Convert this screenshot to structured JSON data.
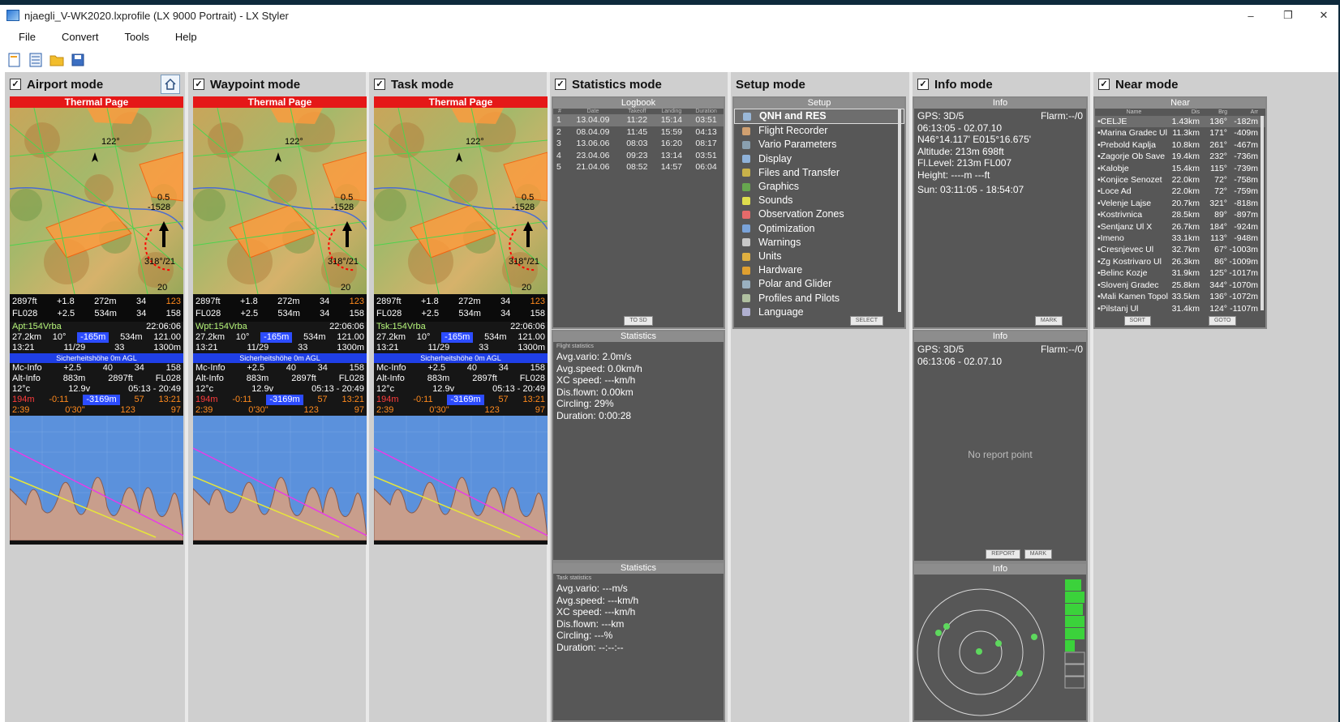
{
  "window": {
    "title": "njaegli_V-WK2020.lxprofile (LX 9000 Portrait) - LX Styler",
    "minimize": "–",
    "restore": "❐",
    "close": "✕"
  },
  "menu": [
    "File",
    "Convert",
    "Tools",
    "Help"
  ],
  "toolbar": {
    "icons": [
      "new-icon",
      "list-icon",
      "open-folder-icon",
      "save-icon"
    ]
  },
  "columns": {
    "airport": {
      "title": "Airport mode",
      "checked": true
    },
    "waypoint": {
      "title": "Waypoint mode",
      "checked": true
    },
    "task": {
      "title": "Task mode",
      "checked": true
    },
    "statistics": {
      "title": "Statistics mode",
      "checked": true
    },
    "setup": {
      "title": "Setup mode",
      "checked": false
    },
    "info": {
      "title": "Info mode",
      "checked": true
    },
    "near": {
      "title": "Near mode",
      "checked": true
    }
  },
  "devices": [
    {
      "id": "airport",
      "map_title": "Thermal Page",
      "nav_name": "Apt:154Vrba",
      "time": "22:06:06",
      "alt": "2897ft",
      "fl": "FL028",
      "vario": "+1.8",
      "agl": "272m",
      "mc": "34",
      "gs": "123"
    },
    {
      "id": "waypoint",
      "map_title": "Thermal Page",
      "nav_name": "Wpt:154Vrba",
      "time": "22:06:06",
      "alt": "2897ft",
      "fl": "FL028",
      "vario": "+1.8",
      "agl": "272m",
      "mc": "34",
      "gs": "123"
    },
    {
      "id": "task",
      "map_title": "Thermal Page",
      "nav_name": "Tsk:154Vrba",
      "time": "22:06:06",
      "alt": "2897ft",
      "fl": "FL028",
      "vario": "+1.8",
      "agl": "272m",
      "mc": "34",
      "gs": "123"
    }
  ],
  "device_common": {
    "bearing": "122°",
    "wind": "318°/21",
    "wind_alt": "0.5",
    "wind_val": "-1528",
    "scale": "20",
    "nav_row1": [
      "27.2km",
      "10°",
      "-165m",
      "534m",
      "121.00"
    ],
    "nav_row2": [
      "13:21",
      "11/29",
      "33",
      "1300m"
    ],
    "safety": "Sicherheitshöhe 0m AGL",
    "mc_info": "Mc-Info",
    "mc_vals": [
      "+2.5",
      "40",
      "34",
      "158"
    ],
    "alt_info": "Alt-Info",
    "alt_vals": [
      "883m",
      "2897ft",
      "FL028"
    ],
    "row_oat": [
      "12°c",
      "12.9v",
      "05:13 - 20:49"
    ],
    "row_red": [
      "194m",
      "-0:11",
      "-3169m",
      "57",
      "13:21"
    ],
    "row_time": [
      "2:39",
      "0'30\"",
      "123",
      "97"
    ]
  },
  "statistics": {
    "logbook_title": "Logbook",
    "log_headers": [
      "#",
      "Date",
      "Takeoff",
      "Landing",
      "Duration"
    ],
    "log_rows": [
      [
        "1",
        "13.04.09",
        "11:22",
        "15:14",
        "03:51"
      ],
      [
        "2",
        "08.04.09",
        "11:45",
        "15:59",
        "04:13"
      ],
      [
        "3",
        "13.06.06",
        "08:03",
        "16:20",
        "08:17"
      ],
      [
        "4",
        "23.04.06",
        "09:23",
        "13:14",
        "03:51"
      ],
      [
        "5",
        "21.04.06",
        "08:52",
        "14:57",
        "06:04"
      ]
    ],
    "to_sd": "TO SD",
    "flight_title": "Statistics",
    "flight_sub": "Flight statistics",
    "flight_lines": [
      "Avg.vario:  2.0m/s",
      "Avg.speed: 0.0km/h",
      "XC speed: ---km/h",
      "Dis.flown: 0.00km",
      "Circling: 29%",
      "Duration:  0:00:28"
    ],
    "task_title": "Statistics",
    "task_sub": "Task statistics",
    "task_lines": [
      "Avg.vario: ---m/s",
      "Avg.speed: ---km/h",
      "XC speed: ---km/h",
      "Dis.flown: ---km",
      "Circling: ---%",
      "Duration: --:--:--"
    ]
  },
  "setup": {
    "title": "Setup",
    "items": [
      {
        "label": "QNH and RES",
        "icon": "qnh-icon",
        "color": "#9ab8d8"
      },
      {
        "label": "Flight Recorder",
        "icon": "recorder-icon",
        "color": "#d0a070"
      },
      {
        "label": "Vario Parameters",
        "icon": "vario-icon",
        "color": "#8aa0b0"
      },
      {
        "label": "Display",
        "icon": "display-icon",
        "color": "#8fb2d9"
      },
      {
        "label": "Files and Transfer",
        "icon": "files-icon",
        "color": "#c9b24a"
      },
      {
        "label": "Graphics",
        "icon": "graphics-icon",
        "color": "#67a74f"
      },
      {
        "label": "Sounds",
        "icon": "sounds-icon",
        "color": "#dede4d"
      },
      {
        "label": "Observation Zones",
        "icon": "zones-icon",
        "color": "#e66a6a"
      },
      {
        "label": "Optimization",
        "icon": "optimization-icon",
        "color": "#7aa3d9"
      },
      {
        "label": "Warnings",
        "icon": "warnings-icon",
        "color": "#c8c8c8"
      },
      {
        "label": "Units",
        "icon": "units-icon",
        "color": "#e0b040"
      },
      {
        "label": "Hardware",
        "icon": "hardware-icon",
        "color": "#e0a030"
      },
      {
        "label": "Polar and Glider",
        "icon": "polar-icon",
        "color": "#9ab0c0"
      },
      {
        "label": "Profiles and Pilots",
        "icon": "profiles-icon",
        "color": "#b0c0a0"
      },
      {
        "label": "Language",
        "icon": "language-icon",
        "color": "#b0b0d0"
      }
    ],
    "select": "SELECT"
  },
  "info": {
    "title": "Info",
    "gps": "GPS: 3D/5",
    "flarm": "Flarm:--/0",
    "datetime": "06:13:05 - 02.07.10",
    "coords": "N46°14.117'  E015°16.675'",
    "altitude": "Altitude:  213m   698ft",
    "fllevel": "Fl.Level:  213m   FL007",
    "height": "Height:   ----m   ---ft",
    "sun": "Sun: 03:11:05 - 18:54:07",
    "mark": "MARK",
    "title2": "Info",
    "gps2": "GPS: 3D/5",
    "flarm2": "Flarm:--/0",
    "datetime2": "06:13:06 - 02.07.10",
    "no_report": "No report point",
    "report": "REPORT",
    "mark2": "MARK",
    "title3": "Info"
  },
  "near": {
    "title": "Near",
    "headers": [
      "Name",
      "Dis",
      "Brg",
      "Arr"
    ],
    "rows": [
      [
        "CELJE",
        "1.43km",
        "136°",
        "-182m"
      ],
      [
        "Marina Gradec Ul",
        "11.3km",
        "171°",
        "-409m"
      ],
      [
        "Prebold Kaplja",
        "10.8km",
        "261°",
        "-467m"
      ],
      [
        "Zagorje Ob Save",
        "19.4km",
        "232°",
        "-736m"
      ],
      [
        "Kalobje",
        "15.4km",
        "115°",
        "-739m"
      ],
      [
        "Konjice Senozet",
        "22.0km",
        "72°",
        "-758m"
      ],
      [
        "Loce Ad",
        "22.0km",
        "72°",
        "-759m"
      ],
      [
        "Velenje Lajse",
        "20.7km",
        "321°",
        "-818m"
      ],
      [
        "Kostrivnica",
        "28.5km",
        "89°",
        "-897m"
      ],
      [
        "Sentjanz Ul X",
        "26.7km",
        "184°",
        "-924m"
      ],
      [
        "Imeno",
        "33.1km",
        "113°",
        "-948m"
      ],
      [
        "Cresnjevec Ul",
        "32.7km",
        "67°",
        "-1003m"
      ],
      [
        "Zg Kostrivaro Ul",
        "26.3km",
        "86°",
        "-1009m"
      ],
      [
        "Belinc Kozje",
        "31.9km",
        "125°",
        "-1017m"
      ],
      [
        "Slovenj Gradec",
        "25.8km",
        "344°",
        "-1070m"
      ],
      [
        "Mali Kamen Topol",
        "33.5km",
        "136°",
        "-1072m"
      ],
      [
        "Pilstanj Ul",
        "31.4km",
        "124°",
        "-1107m"
      ]
    ],
    "sort": "SORT",
    "goto": "GOTO"
  }
}
